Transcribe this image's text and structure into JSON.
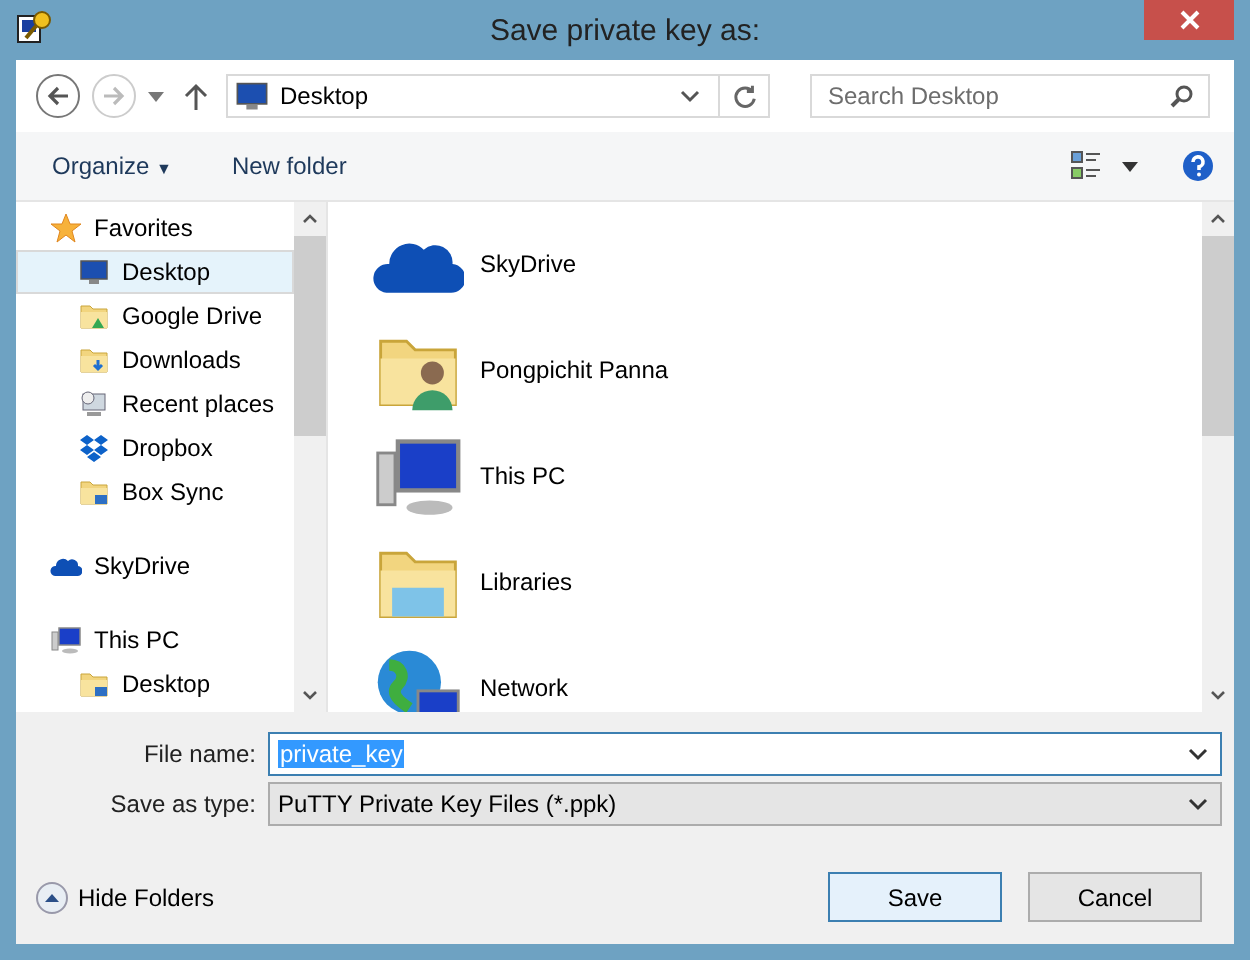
{
  "window": {
    "title": "Save private key as:"
  },
  "nav": {
    "location": "Desktop",
    "search": {
      "placeholder": "Search Desktop"
    }
  },
  "toolbar": {
    "organize": "Organize",
    "organize_caret": "▼",
    "new_folder": "New folder"
  },
  "sidebar": {
    "items": [
      {
        "label": "Favorites",
        "kind": "star",
        "selected": false,
        "children": [
          {
            "label": "Desktop",
            "kind": "desktop",
            "selected": true
          },
          {
            "label": "Google Drive",
            "kind": "folder-drive",
            "selected": false
          },
          {
            "label": "Downloads",
            "kind": "folder-download",
            "selected": false
          },
          {
            "label": "Recent places",
            "kind": "recent",
            "selected": false
          },
          {
            "label": "Dropbox",
            "kind": "dropbox",
            "selected": false
          },
          {
            "label": "Box Sync",
            "kind": "folder-box",
            "selected": false
          }
        ]
      },
      {
        "label": "SkyDrive",
        "kind": "cloud",
        "selected": false
      },
      {
        "label": "This PC",
        "kind": "pc",
        "selected": false,
        "children": [
          {
            "label": "Desktop",
            "kind": "folder-desktop",
            "selected": false
          }
        ]
      }
    ]
  },
  "files": [
    {
      "name": "SkyDrive",
      "kind": "cloud"
    },
    {
      "name": "Pongpichit Panna",
      "kind": "folder-user"
    },
    {
      "name": "This PC",
      "kind": "pc"
    },
    {
      "name": "Libraries",
      "kind": "libraries"
    },
    {
      "name": "Network",
      "kind": "network"
    }
  ],
  "file_name": {
    "label": "File name:",
    "value": "private_key"
  },
  "save_type": {
    "label": "Save as type:",
    "value": "PuTTY Private Key Files (*.ppk)"
  },
  "hide_folders": "Hide Folders",
  "buttons": [
    {
      "label": "Save",
      "kind": "primary"
    },
    {
      "label": "Cancel",
      "kind": "normal"
    }
  ]
}
